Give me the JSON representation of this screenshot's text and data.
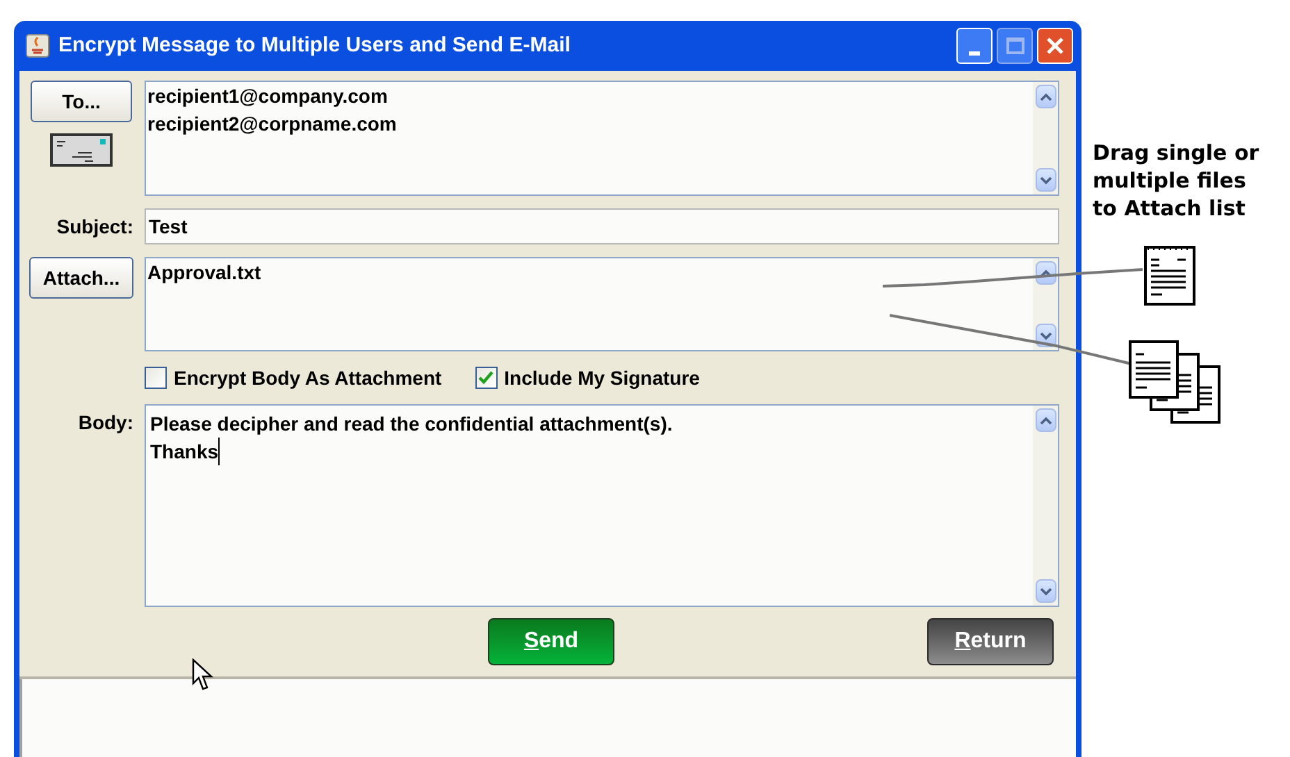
{
  "window": {
    "title": "Encrypt Message to Multiple Users and Send E-Mail"
  },
  "to": {
    "button": "To...",
    "recipients": [
      "recipient1@company.com",
      "recipient2@corpname.com"
    ]
  },
  "subject": {
    "label": "Subject:",
    "value": "Test"
  },
  "attach": {
    "button": "Attach...",
    "files": [
      "Approval.txt"
    ]
  },
  "options": [
    {
      "label": "Encrypt Body As Attachment",
      "checked": false
    },
    {
      "label": "Include My Signature",
      "checked": true
    }
  ],
  "body": {
    "label": "Body:",
    "lines": [
      "Please decipher and read the confidential attachment(s).",
      "Thanks"
    ]
  },
  "buttons": [
    {
      "label": "Send",
      "kind": "primary",
      "mnemonic": true
    },
    {
      "label": "Return",
      "kind": "secondary",
      "mnemonic": true
    }
  ],
  "annotation": {
    "lines": [
      "Drag single or",
      "multiple files",
      "to Attach list"
    ]
  }
}
